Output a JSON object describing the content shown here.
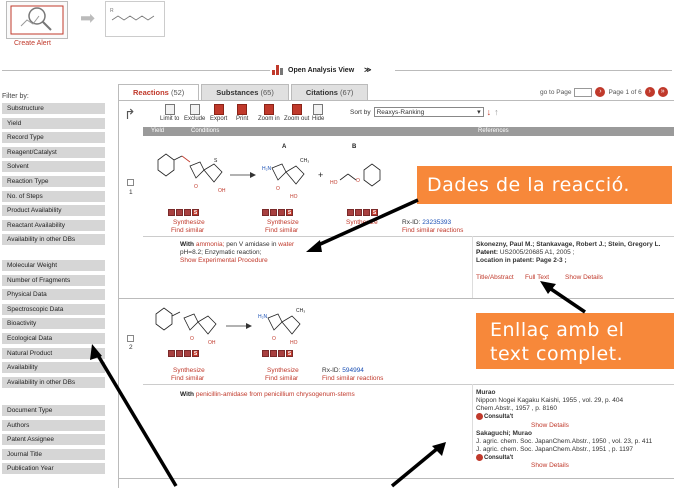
{
  "header": {
    "alert_label": "Create Alert",
    "analysis_view": "Open Analysis View"
  },
  "sidebar": {
    "filter_title": "Filter by:",
    "group1": [
      "Substructure",
      "Yield",
      "Record Type",
      "Reagent/Catalyst",
      "Solvent",
      "Reaction Type",
      "No. of Steps",
      "Product Availability",
      "Reactant Availability",
      "Availability in other DBs"
    ],
    "group2": [
      "Molecular Weight",
      "Number of Fragments",
      "Physical Data",
      "Spectroscopic Data",
      "Bioactivity",
      "Ecological Data",
      "Natural Product",
      "Availability",
      "Availability in other DBs"
    ],
    "group3": [
      "Document Type",
      "Authors",
      "Patent Assignee",
      "Journal Title",
      "Publication Year"
    ]
  },
  "tabs": [
    {
      "label": "Reactions",
      "count": "(52)"
    },
    {
      "label": "Substances",
      "count": "(65)"
    },
    {
      "label": "Citations",
      "count": "(67)"
    }
  ],
  "pager": {
    "goto_label": "go to Page",
    "page_text": "Page  1 of 6"
  },
  "toolbar": {
    "buttons": [
      "Limit to",
      "Exclude",
      "Export",
      "Print",
      "Zoom in",
      "Zoom out",
      "Hide"
    ],
    "sort_label": "Sort by",
    "sort_value": "Reaxys-Ranking"
  },
  "columns": {
    "yield": "Yield",
    "conditions": "Conditions",
    "references": "References"
  },
  "rows": [
    {
      "num": "1",
      "labelA": "A",
      "labelB": "B",
      "links": {
        "synth1": "Synthesize",
        "find1": "Find similar",
        "synth2": "Synthesize",
        "find2": "Find similar",
        "synth3": "Synthesize",
        "find3": "Find similar reactions"
      },
      "rxid_label": "Rx-ID:",
      "rxid": "23235393",
      "cond_with": "With",
      "cond_reagent1": "ammonia;",
      "cond_mid": "pen V amidase",
      "cond_in": "in",
      "cond_solvent": "water",
      "cond_line2": "pH=8.2; Enzymatic reaction;",
      "cond_show": "Show Experimental Procedure",
      "ref_authors": "Skonezny, Paul M.; Stankavage, Robert J.; Stein, Gregory L.",
      "ref_patent_label": "Patent:",
      "ref_patent": "US2005/20685 A1, 2005 ;",
      "ref_location": "Location in patent: Page 2-3 ;",
      "ref_title": "Title/Abstract",
      "ref_fulltext": "Full Text",
      "ref_details": "Show Details"
    },
    {
      "num": "2",
      "links": {
        "synth1": "Synthesize",
        "find1": "Find similar",
        "synth2": "Synthesize",
        "find2": "Find similar",
        "find3": "Find similar reactions"
      },
      "rxid_label": "Rx-ID:",
      "rxid": "594994",
      "cond_with": "With",
      "cond_reagent": "penicillin-amidase from penicillium chrysogenum-stems",
      "ref1_author": "Murao",
      "ref1_line1": "Nippon Nogei Kagaku Kaishi, 1955 , vol. 29, p. 404",
      "ref1_line2": "Chem.Abstr., 1957 , p. 8160",
      "consulta": "Consulta't",
      "ref_details": "Show Details",
      "ref2_author": "Sakaguchi; Murao",
      "ref2_line1": "J. agric. chem. Soc. JapanChem.Abstr., 1950 , vol. 23, p. 411",
      "ref2_line2": "J. agric. chem. Soc. JapanChem.Abstr., 1951 , p. 1197"
    }
  ],
  "callouts": {
    "c1": "Dades de la reacció.",
    "c2_line1": "Enllaç amb el",
    "c2_line2": "text complet."
  },
  "colors": {
    "accent": "#c0392b",
    "callout": "#f7883a",
    "sidebar": "#d6d6d6"
  }
}
